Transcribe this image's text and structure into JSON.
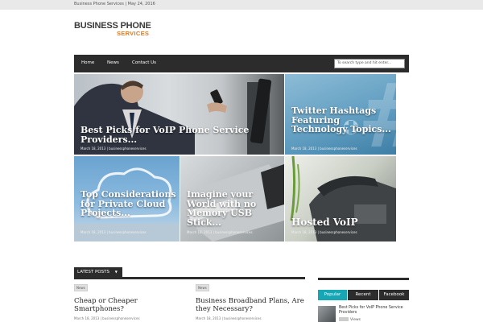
{
  "topbar": {
    "text": "Business Phone Services | May 24, 2016"
  },
  "logo": {
    "main": "BUSINESS PHONE",
    "sub": "SERVICES"
  },
  "nav": {
    "items": [
      {
        "label": "Home"
      },
      {
        "label": "News"
      },
      {
        "label": "Contact Us"
      }
    ],
    "search_placeholder": "To search type and hit enter..."
  },
  "featured": [
    {
      "title": "Best Picks for VoIP Phone Service Providers...",
      "meta": "March 18, 2013 | businessphoneservices"
    },
    {
      "title": "Twitter Hashtags Featuring Technology Topics...",
      "meta": "March 18, 2013 | businessphoneservices"
    },
    {
      "title": "Top Considerations for Private Cloud Projects...",
      "meta": "March 18, 2013 | businessphoneservices"
    },
    {
      "title": "Imagine your World with no Memory USB Stick...",
      "meta": "March 18, 2013 | businessphoneservices"
    },
    {
      "title": "Hosted VoIP",
      "meta": "March 18, 2013 | businessphoneservices"
    }
  ],
  "latest": {
    "label": "LATEST POSTS",
    "arrow": "▼",
    "posts": [
      {
        "tag": "News",
        "title": "Cheap or Cheaper Smartphones?",
        "meta": "March 18, 2013 | businessphoneservices"
      },
      {
        "tag": "News",
        "title": "Business Broadband Plans, Are they Necessary?",
        "meta": "March 18, 2013 | businessphoneservices"
      }
    ]
  },
  "sidebar": {
    "tabs": [
      {
        "label": "Popular"
      },
      {
        "label": "Recent"
      },
      {
        "label": "Facebook"
      }
    ],
    "post": {
      "title": "Best Picks for VoIP Phone Service Providers",
      "views": "Views"
    }
  },
  "colors": {
    "accent": "#e8791d",
    "nav_bg": "#2c2c2c",
    "tab_active": "#17a6b4"
  }
}
